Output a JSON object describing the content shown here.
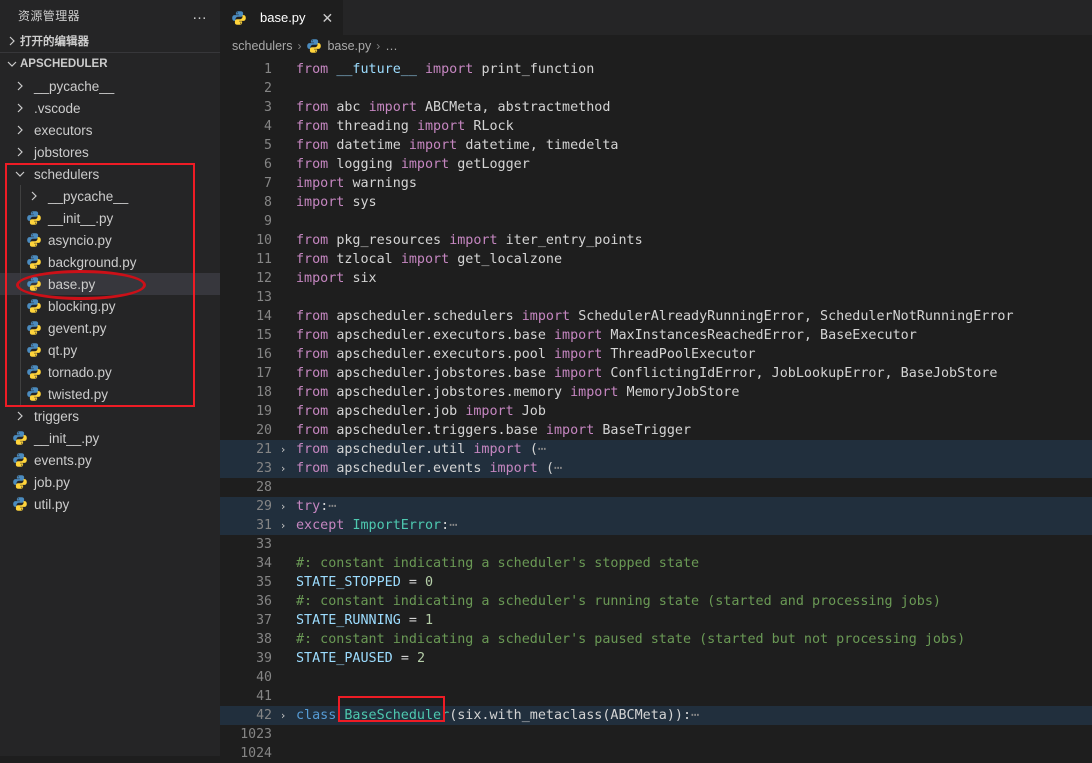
{
  "sidebar": {
    "header_title": "资源管理器",
    "more_actions": "…",
    "open_editors_label": "打开的编辑器",
    "workspace_label": "APSCHEDULER",
    "items": [
      {
        "label": "__pycache__",
        "type": "folder",
        "indent": 1,
        "expanded": false
      },
      {
        "label": ".vscode",
        "type": "folder",
        "indent": 1,
        "expanded": false
      },
      {
        "label": "executors",
        "type": "folder",
        "indent": 1,
        "expanded": false
      },
      {
        "label": "jobstores",
        "type": "folder",
        "indent": 1,
        "expanded": false
      },
      {
        "label": "schedulers",
        "type": "folder",
        "indent": 1,
        "expanded": true
      },
      {
        "label": "__pycache__",
        "type": "folder",
        "indent": 2,
        "expanded": false
      },
      {
        "label": "__init__.py",
        "type": "python",
        "indent": 2
      },
      {
        "label": "asyncio.py",
        "type": "python",
        "indent": 2
      },
      {
        "label": "background.py",
        "type": "python",
        "indent": 2
      },
      {
        "label": "base.py",
        "type": "python",
        "indent": 2,
        "selected": true
      },
      {
        "label": "blocking.py",
        "type": "python",
        "indent": 2
      },
      {
        "label": "gevent.py",
        "type": "python",
        "indent": 2
      },
      {
        "label": "qt.py",
        "type": "python",
        "indent": 2
      },
      {
        "label": "tornado.py",
        "type": "python",
        "indent": 2
      },
      {
        "label": "twisted.py",
        "type": "python",
        "indent": 2
      },
      {
        "label": "triggers",
        "type": "folder",
        "indent": 1,
        "expanded": false
      },
      {
        "label": "__init__.py",
        "type": "python",
        "indent": 1
      },
      {
        "label": "events.py",
        "type": "python",
        "indent": 1
      },
      {
        "label": "job.py",
        "type": "python",
        "indent": 1
      },
      {
        "label": "util.py",
        "type": "python",
        "indent": 1
      }
    ]
  },
  "editor": {
    "tab_label": "base.py",
    "tab_close": "✕",
    "breadcrumb": [
      {
        "label": "schedulers"
      },
      {
        "label": "base.py"
      },
      {
        "label": "…"
      }
    ],
    "breadcrumb_separator": "›"
  },
  "code": {
    "fold_arrow": "›",
    "fold_dots": "⋯",
    "lines": [
      {
        "n": "1",
        "tokens": [
          {
            "t": "from ",
            "c": "k"
          },
          {
            "t": "__future__ ",
            "c": "id"
          },
          {
            "t": "import ",
            "c": "k"
          },
          {
            "t": "print_function",
            "c": "pl"
          }
        ]
      },
      {
        "n": "2",
        "tokens": []
      },
      {
        "n": "3",
        "tokens": [
          {
            "t": "from ",
            "c": "k"
          },
          {
            "t": "abc ",
            "c": "pl"
          },
          {
            "t": "import ",
            "c": "k"
          },
          {
            "t": "ABCMeta, abstractmethod",
            "c": "pl"
          }
        ]
      },
      {
        "n": "4",
        "tokens": [
          {
            "t": "from ",
            "c": "k"
          },
          {
            "t": "threading ",
            "c": "pl"
          },
          {
            "t": "import ",
            "c": "k"
          },
          {
            "t": "RLock",
            "c": "pl"
          }
        ]
      },
      {
        "n": "5",
        "tokens": [
          {
            "t": "from ",
            "c": "k"
          },
          {
            "t": "datetime ",
            "c": "pl"
          },
          {
            "t": "import ",
            "c": "k"
          },
          {
            "t": "datetime, timedelta",
            "c": "pl"
          }
        ]
      },
      {
        "n": "6",
        "tokens": [
          {
            "t": "from ",
            "c": "k"
          },
          {
            "t": "logging ",
            "c": "pl"
          },
          {
            "t": "import ",
            "c": "k"
          },
          {
            "t": "getLogger",
            "c": "pl"
          }
        ]
      },
      {
        "n": "7",
        "tokens": [
          {
            "t": "import ",
            "c": "k"
          },
          {
            "t": "warnings",
            "c": "pl"
          }
        ]
      },
      {
        "n": "8",
        "tokens": [
          {
            "t": "import ",
            "c": "k"
          },
          {
            "t": "sys",
            "c": "pl"
          }
        ]
      },
      {
        "n": "9",
        "tokens": []
      },
      {
        "n": "10",
        "tokens": [
          {
            "t": "from ",
            "c": "k"
          },
          {
            "t": "pkg_resources ",
            "c": "pl"
          },
          {
            "t": "import ",
            "c": "k"
          },
          {
            "t": "iter_entry_points",
            "c": "pl"
          }
        ]
      },
      {
        "n": "11",
        "tokens": [
          {
            "t": "from ",
            "c": "k"
          },
          {
            "t": "tzlocal ",
            "c": "pl"
          },
          {
            "t": "import ",
            "c": "k"
          },
          {
            "t": "get_localzone",
            "c": "pl"
          }
        ]
      },
      {
        "n": "12",
        "tokens": [
          {
            "t": "import ",
            "c": "k"
          },
          {
            "t": "six",
            "c": "pl"
          }
        ]
      },
      {
        "n": "13",
        "tokens": []
      },
      {
        "n": "14",
        "tokens": [
          {
            "t": "from ",
            "c": "k"
          },
          {
            "t": "apscheduler.schedulers ",
            "c": "pl"
          },
          {
            "t": "import ",
            "c": "k"
          },
          {
            "t": "SchedulerAlreadyRunningError, SchedulerNotRunningError",
            "c": "pl"
          }
        ]
      },
      {
        "n": "15",
        "tokens": [
          {
            "t": "from ",
            "c": "k"
          },
          {
            "t": "apscheduler.executors.base ",
            "c": "pl"
          },
          {
            "t": "import ",
            "c": "k"
          },
          {
            "t": "MaxInstancesReachedError, BaseExecutor",
            "c": "pl"
          }
        ]
      },
      {
        "n": "16",
        "tokens": [
          {
            "t": "from ",
            "c": "k"
          },
          {
            "t": "apscheduler.executors.pool ",
            "c": "pl"
          },
          {
            "t": "import ",
            "c": "k"
          },
          {
            "t": "ThreadPoolExecutor",
            "c": "pl"
          }
        ]
      },
      {
        "n": "17",
        "tokens": [
          {
            "t": "from ",
            "c": "k"
          },
          {
            "t": "apscheduler.jobstores.base ",
            "c": "pl"
          },
          {
            "t": "import ",
            "c": "k"
          },
          {
            "t": "ConflictingIdError, JobLookupError, BaseJobStore",
            "c": "pl"
          }
        ]
      },
      {
        "n": "18",
        "tokens": [
          {
            "t": "from ",
            "c": "k"
          },
          {
            "t": "apscheduler.jobstores.memory ",
            "c": "pl"
          },
          {
            "t": "import ",
            "c": "k"
          },
          {
            "t": "MemoryJobStore",
            "c": "pl"
          }
        ]
      },
      {
        "n": "19",
        "tokens": [
          {
            "t": "from ",
            "c": "k"
          },
          {
            "t": "apscheduler.job ",
            "c": "pl"
          },
          {
            "t": "import ",
            "c": "k"
          },
          {
            "t": "Job",
            "c": "pl"
          }
        ]
      },
      {
        "n": "20",
        "tokens": [
          {
            "t": "from ",
            "c": "k"
          },
          {
            "t": "apscheduler.triggers.base ",
            "c": "pl"
          },
          {
            "t": "import ",
            "c": "k"
          },
          {
            "t": "BaseTrigger",
            "c": "pl"
          }
        ]
      },
      {
        "n": "21",
        "folded": true,
        "tokens": [
          {
            "t": "from ",
            "c": "k"
          },
          {
            "t": "apscheduler.util ",
            "c": "pl"
          },
          {
            "t": "import ",
            "c": "k"
          },
          {
            "t": "(",
            "c": "pl"
          },
          {
            "t": "⋯",
            "c": "dots"
          }
        ]
      },
      {
        "n": "23",
        "folded": true,
        "tokens": [
          {
            "t": "from ",
            "c": "k"
          },
          {
            "t": "apscheduler.events ",
            "c": "pl"
          },
          {
            "t": "import ",
            "c": "k"
          },
          {
            "t": "(",
            "c": "pl"
          },
          {
            "t": "⋯",
            "c": "dots"
          }
        ]
      },
      {
        "n": "28",
        "tokens": []
      },
      {
        "n": "29",
        "folded": true,
        "tokens": [
          {
            "t": "try",
            "c": "k"
          },
          {
            "t": ":",
            "c": "pl"
          },
          {
            "t": "⋯",
            "c": "dots"
          }
        ]
      },
      {
        "n": "31",
        "folded": true,
        "tokens": [
          {
            "t": "except ",
            "c": "k"
          },
          {
            "t": "ImportError",
            "c": "typ"
          },
          {
            "t": ":",
            "c": "pl"
          },
          {
            "t": "⋯",
            "c": "dots"
          }
        ]
      },
      {
        "n": "33",
        "tokens": []
      },
      {
        "n": "34",
        "tokens": [
          {
            "t": "#: constant indicating a scheduler's stopped state",
            "c": "cm"
          }
        ]
      },
      {
        "n": "35",
        "tokens": [
          {
            "t": "STATE_STOPPED ",
            "c": "id"
          },
          {
            "t": "= ",
            "c": "pl"
          },
          {
            "t": "0",
            "c": "num"
          }
        ]
      },
      {
        "n": "36",
        "tokens": [
          {
            "t": "#: constant indicating a scheduler's running state (started and processing jobs)",
            "c": "cm"
          }
        ]
      },
      {
        "n": "37",
        "tokens": [
          {
            "t": "STATE_RUNNING ",
            "c": "id"
          },
          {
            "t": "= ",
            "c": "pl"
          },
          {
            "t": "1",
            "c": "num"
          }
        ]
      },
      {
        "n": "38",
        "tokens": [
          {
            "t": "#: constant indicating a scheduler's paused state (started but not processing jobs)",
            "c": "cm"
          }
        ]
      },
      {
        "n": "39",
        "tokens": [
          {
            "t": "STATE_PAUSED ",
            "c": "id"
          },
          {
            "t": "= ",
            "c": "pl"
          },
          {
            "t": "2",
            "c": "num"
          }
        ]
      },
      {
        "n": "40",
        "tokens": []
      },
      {
        "n": "41",
        "tokens": []
      },
      {
        "n": "42",
        "folded": true,
        "tokens": [
          {
            "t": "class ",
            "c": "kb"
          },
          {
            "t": "BaseScheduler",
            "c": "typ"
          },
          {
            "t": "(six.with_metaclass(ABCMeta)):",
            "c": "pl"
          },
          {
            "t": "⋯",
            "c": "dots"
          }
        ]
      },
      {
        "n": "1023",
        "wide": true,
        "tokens": []
      },
      {
        "n": "1024",
        "wide": true,
        "tokens": []
      }
    ]
  },
  "annotations": {
    "folder_rect_color": "#ee1c25",
    "file_ellipse_color": "#cc1018",
    "class_rect_color": "#ee1c25"
  }
}
